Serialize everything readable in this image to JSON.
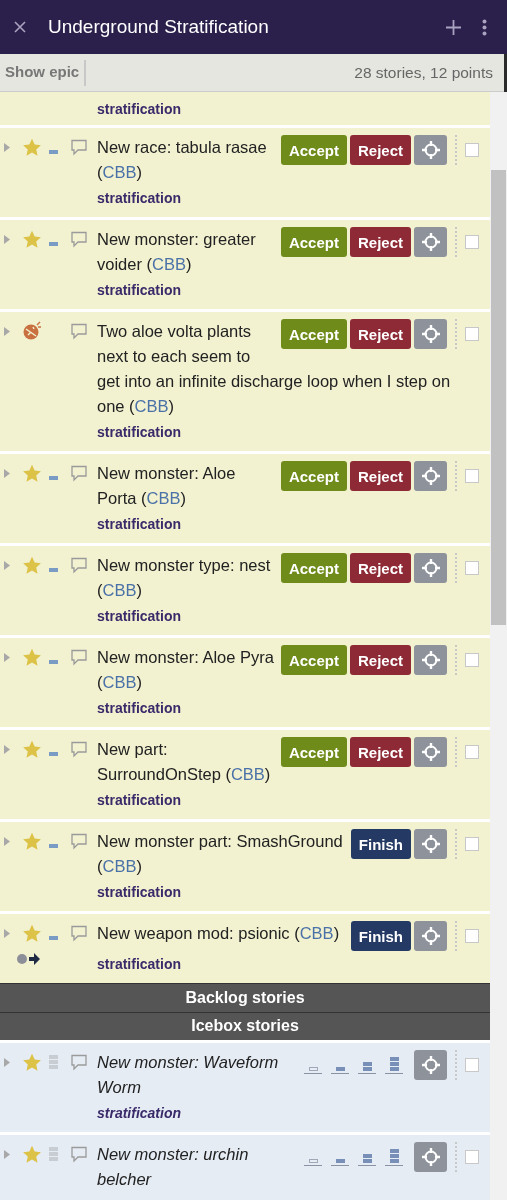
{
  "header": {
    "title": "Underground Stratification"
  },
  "toolbar": {
    "show_epic": "Show epic",
    "summary": "28 stories, 12 points"
  },
  "current": {
    "partial_label": "stratification",
    "stories": [
      {
        "kind": "feature",
        "title": "New race: tabula rasae (",
        "tag": "CBB",
        "close": ")",
        "label": "stratification",
        "estimated": true,
        "has_blocker": false,
        "checked": false,
        "actions": [
          {
            "label": "Accept",
            "kind": "accept"
          },
          {
            "label": "Reject",
            "kind": "reject"
          }
        ]
      },
      {
        "kind": "feature",
        "title": "New monster: greater voider (",
        "tag": "CBB",
        "close": ")",
        "label": "stratification",
        "estimated": true,
        "has_blocker": false,
        "checked": false,
        "actions": [
          {
            "label": "Accept",
            "kind": "accept"
          },
          {
            "label": "Reject",
            "kind": "reject"
          }
        ]
      },
      {
        "kind": "bug",
        "title": "Two aloe volta plants next to each seem to",
        "title_continued": "get into an infinite discharge loop when I step on one (",
        "tag": "CBB",
        "close": ")",
        "label": "stratification",
        "has_blocker": false,
        "checked": false,
        "actions": [
          {
            "label": "Accept",
            "kind": "accept"
          },
          {
            "label": "Reject",
            "kind": "reject"
          }
        ]
      },
      {
        "kind": "feature",
        "title": "New monster: Aloe Porta (",
        "tag": "CBB",
        "close": ")",
        "label": "stratification",
        "estimated": true,
        "has_blocker": false,
        "checked": false,
        "actions": [
          {
            "label": "Accept",
            "kind": "accept"
          },
          {
            "label": "Reject",
            "kind": "reject"
          }
        ]
      },
      {
        "kind": "feature",
        "title": "New monster type: nest (",
        "tag": "CBB",
        "close": ")",
        "label": "stratification",
        "estimated": true,
        "has_blocker": false,
        "checked": false,
        "actions": [
          {
            "label": "Accept",
            "kind": "accept"
          },
          {
            "label": "Reject",
            "kind": "reject"
          }
        ]
      },
      {
        "kind": "feature",
        "title": "New monster: Aloe Pyra (",
        "tag": "CBB",
        "close": ")",
        "label": "stratification",
        "estimated": true,
        "has_blocker": false,
        "checked": false,
        "actions": [
          {
            "label": "Accept",
            "kind": "accept"
          },
          {
            "label": "Reject",
            "kind": "reject"
          }
        ]
      },
      {
        "kind": "feature",
        "title": "New part: SurroundOnStep (",
        "tag": "CBB",
        "close": ")",
        "label": "stratification",
        "estimated": true,
        "has_blocker": false,
        "checked": false,
        "actions": [
          {
            "label": "Accept",
            "kind": "accept"
          },
          {
            "label": "Reject",
            "kind": "reject"
          }
        ]
      },
      {
        "kind": "feature",
        "title": "New monster part: SmashGround (",
        "tag": "CBB",
        "close": ")",
        "label": "stratification",
        "estimated": true,
        "has_blocker": false,
        "checked": false,
        "actions": [
          {
            "label": "Finish",
            "kind": "finish"
          }
        ]
      },
      {
        "kind": "feature",
        "title": "New weapon mod: psionic (",
        "tag": "CBB",
        "close": ")",
        "label": "stratification",
        "estimated": true,
        "has_blocker": true,
        "checked": false,
        "actions": [
          {
            "label": "Finish",
            "kind": "finish"
          }
        ]
      }
    ]
  },
  "sections": [
    {
      "title": "Backlog stories"
    },
    {
      "title": "Icebox stories"
    }
  ],
  "icebox": {
    "stories": [
      {
        "kind": "feature",
        "title": "New monster: Waveform Worm",
        "label": "stratification",
        "estimated": false,
        "has_blocker": false,
        "checked": false
      },
      {
        "kind": "feature",
        "title": "New monster: urchin belcher",
        "estimated": false,
        "has_blocker": false,
        "checked": false
      }
    ]
  }
}
